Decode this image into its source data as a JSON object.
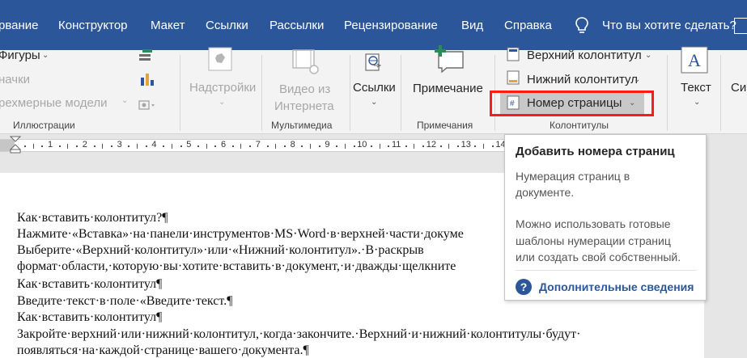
{
  "menu": {
    "tabs": [
      "рвание",
      "Конструктор",
      "Макет",
      "Ссылки",
      "Рассылки",
      "Рецензирование",
      "Вид",
      "Справка"
    ],
    "search_text": "Что вы хотите сделать?"
  },
  "ribbon": {
    "illustrations": {
      "shapes": "Фигуры",
      "icons": "начки",
      "models": "рехмерные модели",
      "label": "Иллюстрации"
    },
    "addins": {
      "line1": "Надстройки"
    },
    "multimedia": {
      "line1": "Видео из",
      "line2": "Интернета",
      "label": "Мультимедиа"
    },
    "links": {
      "line1": "Ссылки"
    },
    "comments": {
      "line1": "Примечание",
      "label": "Примечания"
    },
    "header_footer": {
      "header": "Верхний колонтитул",
      "footer": "Нижний колонтитул",
      "page_number": "Номер страницы",
      "label": "Колонтитулы"
    },
    "text": {
      "line1": "Текст"
    },
    "cut": {
      "line1": "Си"
    }
  },
  "ruler": {
    "numbers": [
      "1",
      "2",
      "3",
      "4",
      "5",
      "6",
      "7",
      "8",
      "9",
      "10",
      "11",
      "12",
      "13",
      "14"
    ]
  },
  "document": {
    "lines": [
      "Как·вставить·колонтитул?¶",
      "Нажмите·«Вставка»·на·панели·инструментов·MS·Word·в·верхней·части·докуме",
      "Выберите·«Верхний·колонтитул»·или·«Нижний·колонтитул».·В·раскрыв",
      "формат·области,·которую·вы·хотите·вставить·в·документ,·и·дважды·щелкните",
      "Как·вставить·колонтитул¶",
      "Введите·текст·в·поле·«Введите·текст.¶",
      "Как·вставить·колонтитул¶",
      "Закройте·верхний·или·нижний·колонтитул,·когда·закончите.·Верхний·и·нижний·колонтитулы·будут·",
      "появляться·на·каждой·странице·вашего·документа.¶"
    ]
  },
  "tooltip": {
    "title": "Добавить номера страниц",
    "desc_line1": "Нумерация страниц в",
    "desc_line2": "документе.",
    "more_line1": "Можно использовать готовые",
    "more_line2": "шаблоны нумерации страниц",
    "more_line3": "или создать свой собственный.",
    "link": "Дополнительные сведения"
  },
  "colors": {
    "accent": "#2b579a",
    "highlight": "#ff1a1a"
  }
}
